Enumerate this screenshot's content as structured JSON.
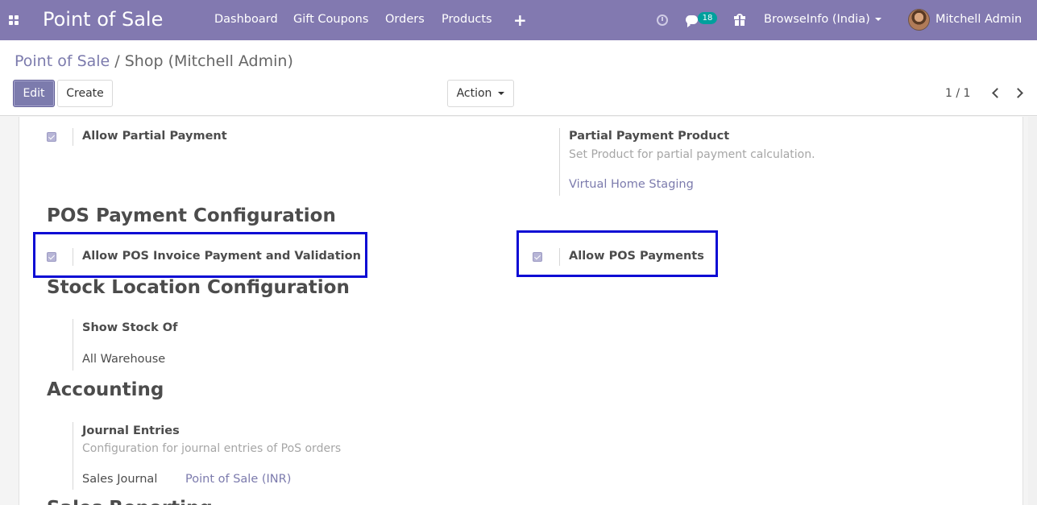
{
  "navbar": {
    "brand": "Point of Sale",
    "menu": [
      "Dashboard",
      "Gift Coupons",
      "Orders",
      "Products"
    ],
    "plus": "+",
    "chat_count": "18",
    "company": "BrowseInfo (India)",
    "user": "Mitchell Admin",
    "icons": [
      "apps-grid-icon",
      "clock-icon",
      "chat-icon",
      "gift-icon"
    ],
    "color": "#8279b0"
  },
  "breadcrumb": {
    "parent": "Point of Sale",
    "separator": "/",
    "current": "Shop (Mitchell Admin)"
  },
  "buttons": {
    "edit": "Edit",
    "create": "Create",
    "action": "Action"
  },
  "pager": {
    "text": "1 / 1"
  },
  "form": {
    "partial_payment": {
      "label": "Allow Partial Payment",
      "checked": true,
      "product_label": "Partial Payment Product",
      "product_help": "Set Product for partial payment calculation.",
      "product_value": "Virtual Home Staging"
    },
    "pos_payment_section": {
      "title": "POS Payment Configuration",
      "invoice_label": "Allow POS Invoice Payment and Validation",
      "invoice_checked": true,
      "payments_label": "Allow POS Payments",
      "payments_checked": true
    },
    "stock_section": {
      "title": "Stock Location Configuration",
      "show_stock_label": "Show Stock Of",
      "show_stock_value": "All Warehouse"
    },
    "accounting_section": {
      "title": "Accounting",
      "journal_label": "Journal Entries",
      "journal_help": "Configuration for journal entries of PoS orders",
      "sales_journal_label": "Sales Journal",
      "sales_journal_value": "Point of Sale (INR)"
    },
    "next_section_title": "Sales Reporting"
  },
  "highlight_color": "#0d0bd4"
}
